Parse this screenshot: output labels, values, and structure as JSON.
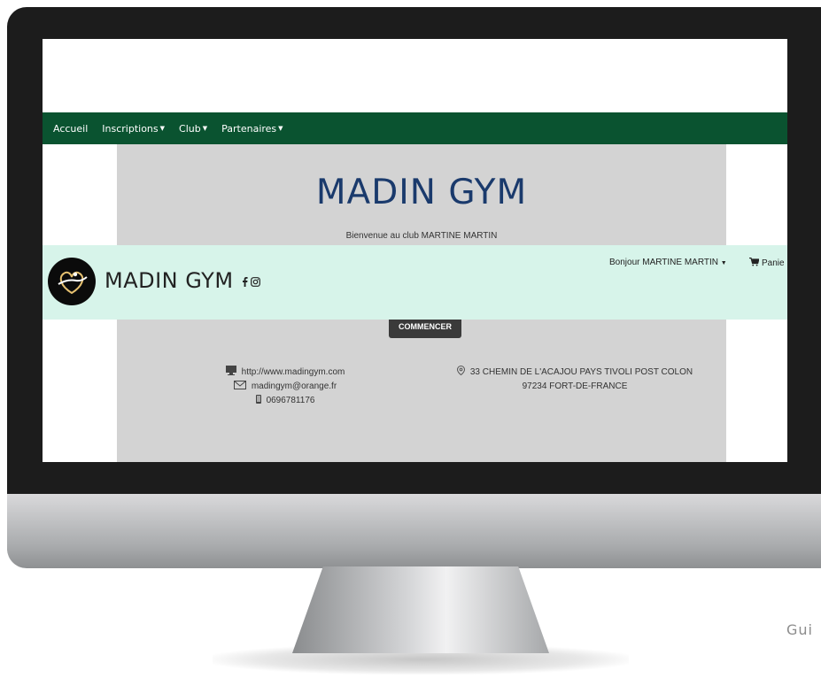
{
  "nav": {
    "items": [
      {
        "label": "Accueil",
        "dropdown": false
      },
      {
        "label": "Inscriptions",
        "dropdown": true
      },
      {
        "label": "Club",
        "dropdown": true
      },
      {
        "label": "Partenaires",
        "dropdown": true
      }
    ]
  },
  "hero": {
    "title": "MADIN GYM",
    "welcome": "Bienvenue au club MARTINE MARTIN",
    "start_button": "COMMENCER"
  },
  "header": {
    "brand": "MADIN GYM",
    "greeting": "Bonjour MARTINE MARTIN",
    "cart": "Panie"
  },
  "contact": {
    "website": "http://www.madingym.com",
    "email": "madingym@orange.fr",
    "phone": "0696781176",
    "address_line1": "33 CHEMIN DE L'ACAJOU PAYS TIVOLI POST COLON",
    "address_line2": "97234 FORT-DE-FRANCE"
  },
  "corner_text": "Gui",
  "colors": {
    "nav": "#0a5330",
    "header_bg": "#d7f4ea",
    "title": "#1a3a6c",
    "panel": "#d3d3d3"
  },
  "icons": [
    "logo-icon",
    "facebook-icon",
    "instagram-icon",
    "monitor-icon",
    "envelope-icon",
    "phone-icon",
    "location-pin-icon",
    "cart-icon",
    "caret-down-icon"
  ]
}
